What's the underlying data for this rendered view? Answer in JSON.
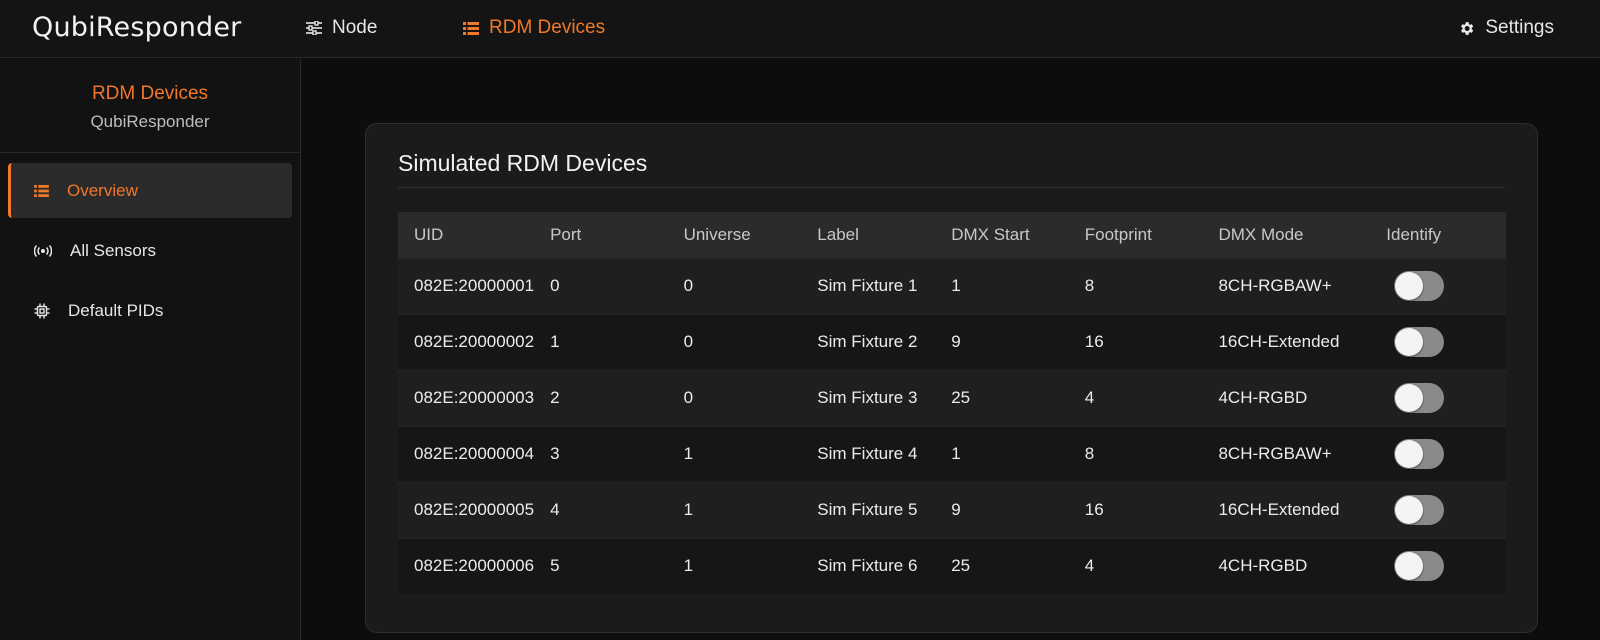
{
  "app": {
    "brand": "QubiResponder"
  },
  "nav": {
    "node_label": "Node",
    "rdm_label": "RDM Devices",
    "settings_label": "Settings"
  },
  "sidebar": {
    "title": "RDM Devices",
    "subtitle": "QubiResponder",
    "items": [
      {
        "label": "Overview",
        "icon": "list-icon",
        "active": true
      },
      {
        "label": "All Sensors",
        "icon": "broadcast-icon",
        "active": false
      },
      {
        "label": "Default PIDs",
        "icon": "chip-icon",
        "active": false
      }
    ]
  },
  "card": {
    "title": "Simulated RDM Devices",
    "columns": [
      "UID",
      "Port",
      "Universe",
      "Label",
      "DMX Start",
      "Footprint",
      "DMX Mode",
      "Identify"
    ],
    "rows": [
      {
        "uid": "082E:20000001",
        "port": "0",
        "universe": "0",
        "label": "Sim Fixture 1",
        "dmx_start": "1",
        "footprint": "8",
        "mode": "8CH-RGBAW+",
        "identify": false
      },
      {
        "uid": "082E:20000002",
        "port": "1",
        "universe": "0",
        "label": "Sim Fixture 2",
        "dmx_start": "9",
        "footprint": "16",
        "mode": "16CH-Extended",
        "identify": false
      },
      {
        "uid": "082E:20000003",
        "port": "2",
        "universe": "0",
        "label": "Sim Fixture 3",
        "dmx_start": "25",
        "footprint": "4",
        "mode": "4CH-RGBD",
        "identify": false
      },
      {
        "uid": "082E:20000004",
        "port": "3",
        "universe": "1",
        "label": "Sim Fixture 4",
        "dmx_start": "1",
        "footprint": "8",
        "mode": "8CH-RGBAW+",
        "identify": false
      },
      {
        "uid": "082E:20000005",
        "port": "4",
        "universe": "1",
        "label": "Sim Fixture 5",
        "dmx_start": "9",
        "footprint": "16",
        "mode": "16CH-Extended",
        "identify": false
      },
      {
        "uid": "082E:20000006",
        "port": "5",
        "universe": "1",
        "label": "Sim Fixture 6",
        "dmx_start": "25",
        "footprint": "4",
        "mode": "4CH-RGBD",
        "identify": false
      }
    ]
  },
  "colors": {
    "accent": "#f0782a",
    "background": "#0d0d0d",
    "card": "#1b1b1b"
  }
}
